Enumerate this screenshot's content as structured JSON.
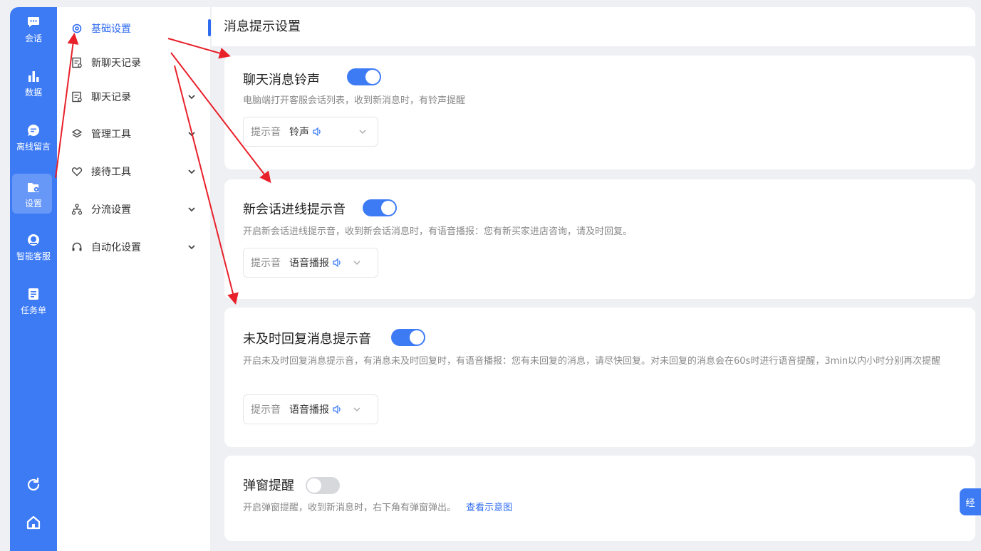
{
  "rail": {
    "items": [
      {
        "label": "会话",
        "icon": "chat-bubble-icon"
      },
      {
        "label": "数据",
        "icon": "bar-chart-icon"
      },
      {
        "label": "离线留言",
        "icon": "message-icon"
      },
      {
        "label": "设置",
        "icon": "settings-folder-icon",
        "active": true
      },
      {
        "label": "智能客服",
        "icon": "robot-icon"
      },
      {
        "label": "任务单",
        "icon": "task-list-icon"
      }
    ]
  },
  "menu": {
    "items": [
      {
        "label": "基础设置",
        "icon": "gear-icon",
        "active": true
      },
      {
        "label": "新聊天记录",
        "icon": "record-icon"
      },
      {
        "label": "聊天记录",
        "icon": "record-icon",
        "expandable": true
      },
      {
        "label": "管理工具",
        "icon": "layers-icon",
        "expandable": true
      },
      {
        "label": "接待工具",
        "icon": "heart-icon",
        "expandable": true
      },
      {
        "label": "分流设置",
        "icon": "sitemap-icon",
        "expandable": true
      },
      {
        "label": "自动化设置",
        "icon": "headset-icon",
        "expandable": true
      }
    ]
  },
  "page": {
    "title": "消息提示设置"
  },
  "cards": [
    {
      "title": "聊天消息铃声",
      "enabled": true,
      "description": "电脑端打开客服会话列表，收到新消息时，有铃声提醒",
      "select_label": "提示音",
      "select_value": "铃声"
    },
    {
      "title": "新会话进线提示音",
      "enabled": true,
      "description": "开启新会话进线提示音，收到新会话消息时，有语音播报：您有新买家进店咨询，请及时回复。",
      "select_label": "提示音",
      "select_value": "语音播报"
    },
    {
      "title": "未及时回复消息提示音",
      "enabled": true,
      "description": "开启未及时回复消息提示音，有消息未及时回复时，有语音播报：您有未回复的消息，请尽快回复。对未回复的消息会在60s时进行语音提醒，3min以内小时分别再次提醒",
      "select_label": "提示音",
      "select_value": "语音播报"
    },
    {
      "title": "弹窗提醒",
      "enabled": false,
      "description": "开启弹窗提醒，收到新消息时，右下角有弹窗弹出。",
      "link": "查看示意图"
    }
  ],
  "float_button": {
    "label": "经"
  },
  "colors": {
    "accent": "#3d7bf5",
    "annotation": "#e8202a"
  }
}
